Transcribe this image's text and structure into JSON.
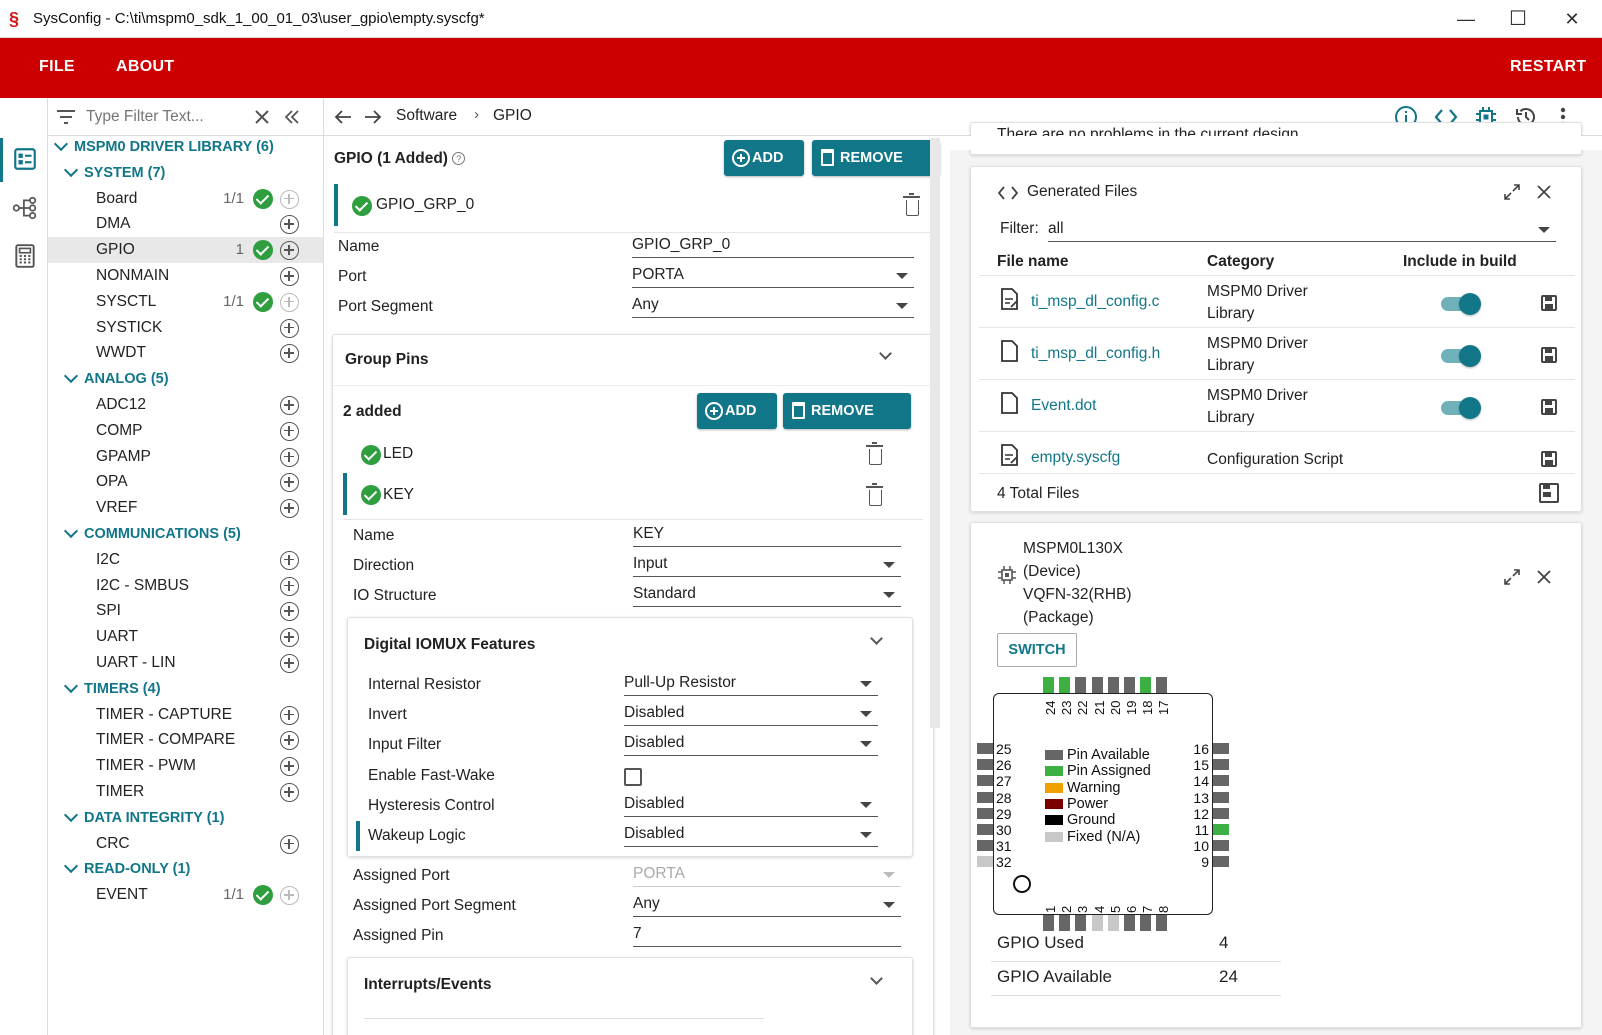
{
  "window": {
    "title": "SysConfig - C:\\ti\\mspm0_sdk_1_00_01_03\\user_gpio\\empty.syscfg*",
    "minimize": "—",
    "maximize": "☐",
    "close": "✕"
  },
  "menu": {
    "file": "FILE",
    "about": "ABOUT",
    "restart": "RESTART"
  },
  "filter": {
    "placeholder": "Type Filter Text..."
  },
  "tree": {
    "library": "MSPM0 DRIVER LIBRARY (6)",
    "groups": [
      {
        "label": "SYSTEM (7)",
        "items": [
          {
            "label": "Board",
            "count": "1/1",
            "ok": true
          },
          {
            "label": "DMA"
          },
          {
            "label": "GPIO",
            "count": "1",
            "ok": true,
            "selected": true
          },
          {
            "label": "NONMAIN"
          },
          {
            "label": "SYSCTL",
            "count": "1/1",
            "ok": true
          },
          {
            "label": "SYSTICK"
          },
          {
            "label": "WWDT"
          }
        ]
      },
      {
        "label": "ANALOG (5)",
        "items": [
          {
            "label": "ADC12"
          },
          {
            "label": "COMP"
          },
          {
            "label": "GPAMP"
          },
          {
            "label": "OPA"
          },
          {
            "label": "VREF"
          }
        ]
      },
      {
        "label": "COMMUNICATIONS (5)",
        "items": [
          {
            "label": "I2C"
          },
          {
            "label": "I2C - SMBUS"
          },
          {
            "label": "SPI"
          },
          {
            "label": "UART"
          },
          {
            "label": "UART - LIN"
          }
        ]
      },
      {
        "label": "TIMERS (4)",
        "items": [
          {
            "label": "TIMER - CAPTURE"
          },
          {
            "label": "TIMER - COMPARE"
          },
          {
            "label": "TIMER - PWM"
          },
          {
            "label": "TIMER"
          }
        ]
      },
      {
        "label": "DATA INTEGRITY (1)",
        "items": [
          {
            "label": "CRC"
          }
        ]
      },
      {
        "label": "READ-ONLY (1)",
        "items": [
          {
            "label": "EVENT",
            "count": "1/1",
            "ok": true
          }
        ]
      }
    ]
  },
  "breadcrumb": {
    "root": "Software",
    "sep": "›",
    "current": "GPIO"
  },
  "gpio": {
    "title": "GPIO (1 Added)",
    "help": "?",
    "add": "ADD",
    "remove_all": "REMOVE ALL",
    "instance": "GPIO_GRP_0",
    "fields": [
      {
        "label": "Name",
        "value": "GPIO_GRP_0"
      },
      {
        "label": "Port",
        "value": "PORTA"
      },
      {
        "label": "Port Segment",
        "value": "Any"
      }
    ],
    "group_pins": {
      "title": "Group Pins",
      "added": "2 added",
      "add": "ADD",
      "remove_all": "REMOVE ALL",
      "pins": [
        "LED",
        "KEY"
      ],
      "fields": [
        {
          "label": "Name",
          "value": "KEY"
        },
        {
          "label": "Direction",
          "value": "Input"
        },
        {
          "label": "IO Structure",
          "value": "Standard"
        }
      ],
      "iomux": {
        "title": "Digital IOMUX Features",
        "fields": [
          {
            "label": "Internal Resistor",
            "value": "Pull-Up Resistor"
          },
          {
            "label": "Invert",
            "value": "Disabled"
          },
          {
            "label": "Input Filter",
            "value": "Disabled"
          },
          {
            "label": "Enable Fast-Wake",
            "value": ""
          },
          {
            "label": "Hysteresis Control",
            "value": "Disabled"
          },
          {
            "label": "Wakeup Logic",
            "value": "Disabled"
          }
        ]
      },
      "assigned": [
        {
          "label": "Assigned Port",
          "value": "PORTA"
        },
        {
          "label": "Assigned Port Segment",
          "value": "Any"
        },
        {
          "label": "Assigned Pin",
          "value": "7"
        }
      ],
      "interrupts": {
        "title": "Interrupts/Events"
      }
    }
  },
  "problems": {
    "text": "There are no problems in the current design."
  },
  "generated": {
    "title": "Generated Files",
    "filter_label": "Filter:",
    "filter_value": "all",
    "headers": {
      "file": "File name",
      "category": "Category",
      "include": "Include in build"
    },
    "files": [
      {
        "name": "ti_msp_dl_config.c",
        "cat1": "MSPM0 Driver",
        "cat2": "Library",
        "toggle": true
      },
      {
        "name": "ti_msp_dl_config.h",
        "cat1": "MSPM0 Driver",
        "cat2": "Library",
        "toggle": true
      },
      {
        "name": "Event.dot",
        "cat1": "MSPM0 Driver",
        "cat2": "Library",
        "toggle": true
      },
      {
        "name": "empty.syscfg",
        "cat1": "Configuration Script",
        "cat2": "",
        "toggle": false
      }
    ],
    "total": "4 Total Files"
  },
  "device": {
    "name": "MSPM0L130X",
    "device_label": "(Device)",
    "package": "VQFN-32(RHB)",
    "package_label": "(Package)",
    "switch": "SWITCH",
    "top_pins": [
      "24",
      "23",
      "22",
      "21",
      "20",
      "19",
      "18",
      "17"
    ],
    "left_pins": [
      "25",
      "26",
      "27",
      "28",
      "29",
      "30",
      "31",
      "32"
    ],
    "right_pins": [
      "16",
      "15",
      "14",
      "13",
      "12",
      "11",
      "10",
      "9"
    ],
    "bottom_pins": [
      "1",
      "2",
      "3",
      "4",
      "5",
      "6",
      "7",
      "8"
    ],
    "legend": [
      {
        "label": "Pin Available",
        "color": "#666666"
      },
      {
        "label": "Pin Assigned",
        "color": "#3cb043"
      },
      {
        "label": "Warning",
        "color": "#f0a000"
      },
      {
        "label": "Power",
        "color": "#7a0000"
      },
      {
        "label": "Ground",
        "color": "#000000"
      },
      {
        "label": "Fixed (N/A)",
        "color": "#c8c8c8"
      }
    ],
    "gpio_used_label": "GPIO Used",
    "gpio_used": "4",
    "gpio_avail_label": "GPIO Available",
    "gpio_avail": "24"
  }
}
